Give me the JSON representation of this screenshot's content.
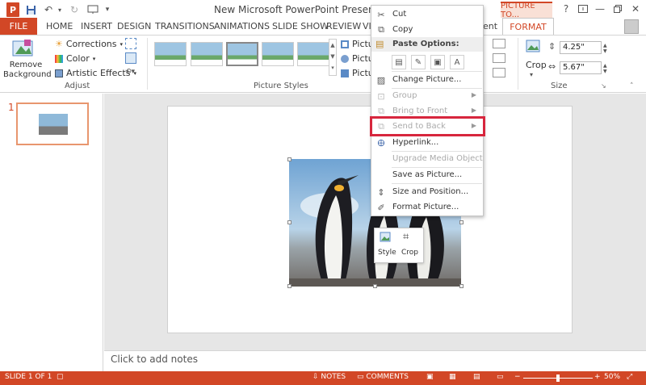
{
  "window": {
    "title": "New Microsoft PowerPoint Presentation - Powe",
    "contextual_tab_header": "PICTURE TO...",
    "logo_letter": "P"
  },
  "tabs": {
    "file": "FILE",
    "items": [
      "HOME",
      "INSERT",
      "DESIGN",
      "TRANSITIONS",
      "ANIMATIONS",
      "SLIDE SHOW",
      "REVIEW",
      "VI"
    ],
    "partial_hidden": "ent",
    "format": "FORMAT"
  },
  "ribbon": {
    "adjust": {
      "remove_background": "Remove Background",
      "corrections": "Corrections",
      "color": "Color",
      "artistic_effects": "Artistic Effects",
      "group_label": "Adjust"
    },
    "picture_styles": {
      "group_label": "Picture Styles",
      "picture_border": "Pictu",
      "picture_effects": "Pictu",
      "picture_layout": "Pictu"
    },
    "size": {
      "crop": "Crop",
      "height": "4.25\"",
      "width": "5.67\"",
      "group_label": "Size"
    }
  },
  "thumbnail": {
    "number": "1"
  },
  "notes": {
    "placeholder": "Click to add notes"
  },
  "mini_toolbar": {
    "style": "Style",
    "crop": "Crop"
  },
  "context_menu": {
    "items": [
      {
        "label": "Cut",
        "icon": "scissors-icon",
        "disabled": false
      },
      {
        "label": "Copy",
        "icon": "copy-icon",
        "disabled": false
      }
    ],
    "paste_header": "Paste Options:",
    "items2": [
      {
        "label": "Change Picture...",
        "icon": "change-picture-icon",
        "disabled": false
      },
      {
        "label": "Group",
        "icon": "group-icon",
        "disabled": true,
        "submenu": true
      },
      {
        "label": "Bring to Front",
        "icon": "bring-front-icon",
        "disabled": true,
        "submenu": true
      },
      {
        "label": "Send to Back",
        "icon": "send-back-icon",
        "disabled": true,
        "submenu": true
      },
      {
        "label": "Hyperlink...",
        "icon": "hyperlink-icon",
        "disabled": false
      },
      {
        "label": "Upgrade Media Object",
        "icon": "",
        "disabled": true
      },
      {
        "label": "Save as Picture...",
        "icon": "",
        "disabled": false
      },
      {
        "label": "Size and Position...",
        "icon": "size-position-icon",
        "disabled": false
      },
      {
        "label": "Format Picture...",
        "icon": "format-picture-icon",
        "disabled": false
      }
    ]
  },
  "status": {
    "slide": "SLIDE 1 OF 1",
    "notes": "NOTES",
    "comments": "COMMENTS",
    "zoom": "50%",
    "zoom_level": 0.5
  },
  "colors": {
    "accent": "#d24726",
    "highlight": "#d7263d"
  }
}
